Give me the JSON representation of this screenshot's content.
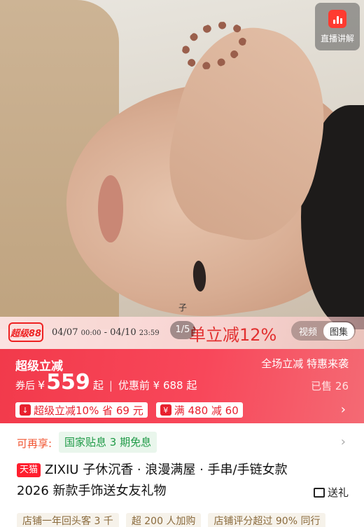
{
  "hero": {
    "watermark": "子",
    "live_label": "直播讲解",
    "page_indicator": "1/5",
    "media_tabs": [
      "视频",
      "图集"
    ],
    "active_media_tab": "图集"
  },
  "promo": {
    "logo_text": "超级88",
    "date_range_start": "04/07",
    "time_start": "00:00",
    "dash": "-",
    "date_range_end": "04/10",
    "time_end": "23:59",
    "slogan": "单立减12%"
  },
  "price": {
    "title": "超级立减",
    "right_title": "全场立减 特惠来袭",
    "after_label": "券后",
    "currency": "¥",
    "price_value": "559",
    "price_suffix": "起",
    "separator": "|",
    "before_label": "优惠前 ¥ 688 起",
    "sold": "已售 26",
    "coupon1": "超级立减10% 省 69 元",
    "coupon2": "满 480 减 60"
  },
  "subsidy": {
    "label": "可再享:",
    "tag": "国家贴息 3 期免息"
  },
  "product": {
    "badge": "天猫",
    "title": "ZIXIU 子休沉香 · 浪漫满屋 · 手串/手链女款 2026 新款手饰送女友礼物",
    "gift_label": "送礼"
  },
  "tags": [
    "店铺一年回头客 3 千",
    "超 200 人加购",
    "店铺评分超过 90% 同行"
  ],
  "colors": {
    "accent": "#f23a4b",
    "green": "#1f9a47"
  }
}
